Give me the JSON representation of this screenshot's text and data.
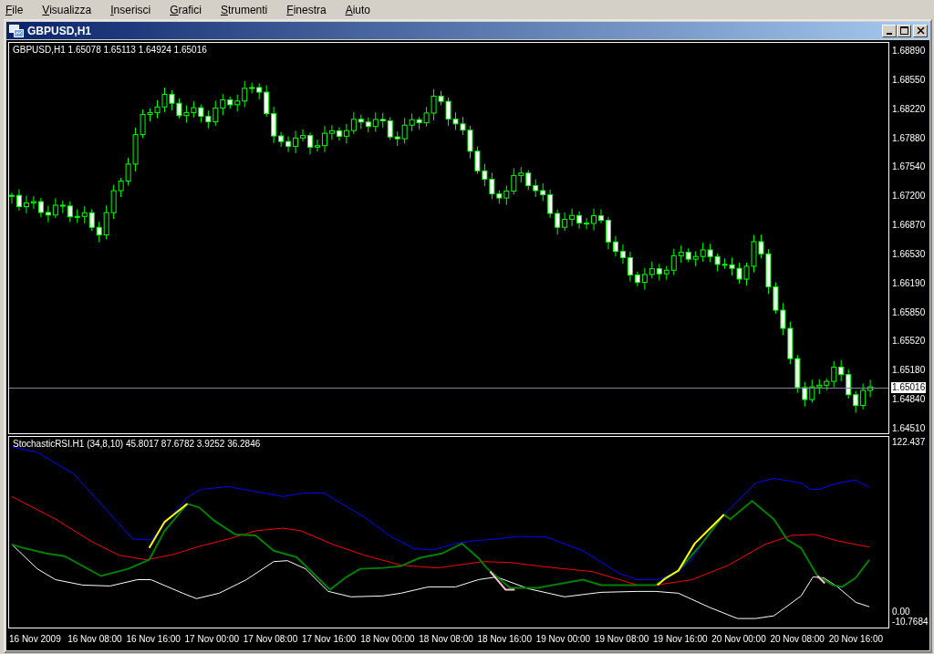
{
  "menu": [
    "File",
    "Visualizza",
    "Inserisci",
    "Grafici",
    "Strumenti",
    "Finestra",
    "Aiuto"
  ],
  "window": {
    "title": "GBPUSD,H1"
  },
  "price_chart": {
    "legend": "GBPUSD,H1  1.65078 1.65113 1.64924 1.65016",
    "price_labels": [
      "1.68890",
      "1.68550",
      "1.68220",
      "1.67880",
      "1.67540",
      "1.67200",
      "1.66870",
      "1.66530",
      "1.66190",
      "1.65850",
      "1.65520",
      "1.65180",
      "1.64840",
      "1.64510"
    ],
    "current_price": "1.65016"
  },
  "indicator": {
    "legend": "StochasticRSI.H1 (34,8,10) 45.8017 87.6782 3.9252 36.2846",
    "scale_labels": [
      "122.437",
      "0.00",
      "-10.7684"
    ]
  },
  "time_labels": [
    "16 Nov 2009",
    "16 Nov 08:00",
    "16 Nov 16:00",
    "17 Nov 00:00",
    "17 Nov 08:00",
    "17 Nov 16:00",
    "18 Nov 00:00",
    "18 Nov 08:00",
    "18 Nov 16:00",
    "19 Nov 00:00",
    "19 Nov 08:00",
    "19 Nov 16:00",
    "20 Nov 00:00",
    "20 Nov 08:00",
    "20 Nov 16:00"
  ]
}
